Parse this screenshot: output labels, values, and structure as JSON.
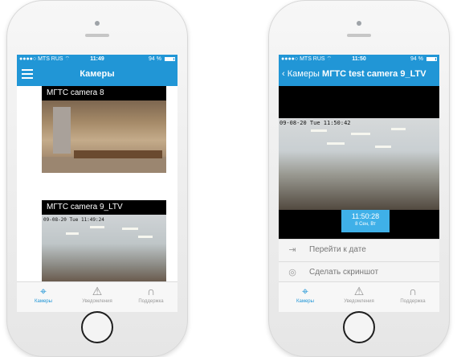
{
  "left_phone": {
    "statusbar": {
      "carrier": "●●●●○ MTS RUS ⌔",
      "time": "11:49",
      "battery": "94 %"
    },
    "nav": {
      "title": "Камеры"
    },
    "cameras": [
      {
        "label": "МГТС camera 8",
        "overlay": ""
      },
      {
        "label": "МГТС camera 9_LTV",
        "overlay": "09-08-20   Tue 11:49:24"
      }
    ],
    "tabs": [
      {
        "label": "Камеры",
        "icon": "camera-icon",
        "active": true
      },
      {
        "label": "Уведомления",
        "icon": "warning-icon",
        "active": false
      },
      {
        "label": "Поддержка",
        "icon": "headphones-icon",
        "active": false
      }
    ]
  },
  "right_phone": {
    "statusbar": {
      "carrier": "●●●●○ MTS RUS ⌔",
      "time": "11:50",
      "battery": "94 %"
    },
    "nav": {
      "back_label": "Камеры",
      "title": "МГТС test camera 9_LTV"
    },
    "video": {
      "overlay": "09-08-20   Tue 11:50:42"
    },
    "timeline": {
      "time": "11:50:28",
      "date": "8 Сен, Вт"
    },
    "actions": [
      {
        "label": "Перейти к дате",
        "icon": "calendar-arrow-icon"
      },
      {
        "label": "Сделать скриншот",
        "icon": "camera-outline-icon"
      }
    ],
    "tabs": [
      {
        "label": "Камеры",
        "icon": "camera-icon",
        "active": true
      },
      {
        "label": "Уведомления",
        "icon": "warning-icon",
        "active": false
      },
      {
        "label": "Поддержка",
        "icon": "headphones-icon",
        "active": false
      }
    ]
  },
  "colors": {
    "accent": "#2196d6",
    "timestamp": "#3fb0e8"
  }
}
